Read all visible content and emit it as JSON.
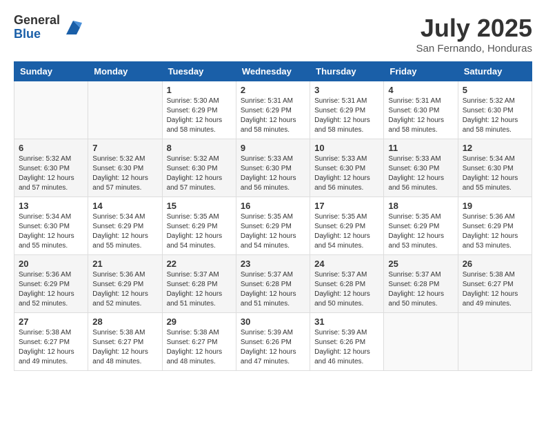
{
  "header": {
    "logo_general": "General",
    "logo_blue": "Blue",
    "month_title": "July 2025",
    "location": "San Fernando, Honduras"
  },
  "days_of_week": [
    "Sunday",
    "Monday",
    "Tuesday",
    "Wednesday",
    "Thursday",
    "Friday",
    "Saturday"
  ],
  "weeks": [
    [
      {
        "day": "",
        "info": ""
      },
      {
        "day": "",
        "info": ""
      },
      {
        "day": "1",
        "info": "Sunrise: 5:30 AM\nSunset: 6:29 PM\nDaylight: 12 hours and 58 minutes."
      },
      {
        "day": "2",
        "info": "Sunrise: 5:31 AM\nSunset: 6:29 PM\nDaylight: 12 hours and 58 minutes."
      },
      {
        "day": "3",
        "info": "Sunrise: 5:31 AM\nSunset: 6:29 PM\nDaylight: 12 hours and 58 minutes."
      },
      {
        "day": "4",
        "info": "Sunrise: 5:31 AM\nSunset: 6:30 PM\nDaylight: 12 hours and 58 minutes."
      },
      {
        "day": "5",
        "info": "Sunrise: 5:32 AM\nSunset: 6:30 PM\nDaylight: 12 hours and 58 minutes."
      }
    ],
    [
      {
        "day": "6",
        "info": "Sunrise: 5:32 AM\nSunset: 6:30 PM\nDaylight: 12 hours and 57 minutes."
      },
      {
        "day": "7",
        "info": "Sunrise: 5:32 AM\nSunset: 6:30 PM\nDaylight: 12 hours and 57 minutes."
      },
      {
        "day": "8",
        "info": "Sunrise: 5:32 AM\nSunset: 6:30 PM\nDaylight: 12 hours and 57 minutes."
      },
      {
        "day": "9",
        "info": "Sunrise: 5:33 AM\nSunset: 6:30 PM\nDaylight: 12 hours and 56 minutes."
      },
      {
        "day": "10",
        "info": "Sunrise: 5:33 AM\nSunset: 6:30 PM\nDaylight: 12 hours and 56 minutes."
      },
      {
        "day": "11",
        "info": "Sunrise: 5:33 AM\nSunset: 6:30 PM\nDaylight: 12 hours and 56 minutes."
      },
      {
        "day": "12",
        "info": "Sunrise: 5:34 AM\nSunset: 6:30 PM\nDaylight: 12 hours and 55 minutes."
      }
    ],
    [
      {
        "day": "13",
        "info": "Sunrise: 5:34 AM\nSunset: 6:30 PM\nDaylight: 12 hours and 55 minutes."
      },
      {
        "day": "14",
        "info": "Sunrise: 5:34 AM\nSunset: 6:29 PM\nDaylight: 12 hours and 55 minutes."
      },
      {
        "day": "15",
        "info": "Sunrise: 5:35 AM\nSunset: 6:29 PM\nDaylight: 12 hours and 54 minutes."
      },
      {
        "day": "16",
        "info": "Sunrise: 5:35 AM\nSunset: 6:29 PM\nDaylight: 12 hours and 54 minutes."
      },
      {
        "day": "17",
        "info": "Sunrise: 5:35 AM\nSunset: 6:29 PM\nDaylight: 12 hours and 54 minutes."
      },
      {
        "day": "18",
        "info": "Sunrise: 5:35 AM\nSunset: 6:29 PM\nDaylight: 12 hours and 53 minutes."
      },
      {
        "day": "19",
        "info": "Sunrise: 5:36 AM\nSunset: 6:29 PM\nDaylight: 12 hours and 53 minutes."
      }
    ],
    [
      {
        "day": "20",
        "info": "Sunrise: 5:36 AM\nSunset: 6:29 PM\nDaylight: 12 hours and 52 minutes."
      },
      {
        "day": "21",
        "info": "Sunrise: 5:36 AM\nSunset: 6:29 PM\nDaylight: 12 hours and 52 minutes."
      },
      {
        "day": "22",
        "info": "Sunrise: 5:37 AM\nSunset: 6:28 PM\nDaylight: 12 hours and 51 minutes."
      },
      {
        "day": "23",
        "info": "Sunrise: 5:37 AM\nSunset: 6:28 PM\nDaylight: 12 hours and 51 minutes."
      },
      {
        "day": "24",
        "info": "Sunrise: 5:37 AM\nSunset: 6:28 PM\nDaylight: 12 hours and 50 minutes."
      },
      {
        "day": "25",
        "info": "Sunrise: 5:37 AM\nSunset: 6:28 PM\nDaylight: 12 hours and 50 minutes."
      },
      {
        "day": "26",
        "info": "Sunrise: 5:38 AM\nSunset: 6:27 PM\nDaylight: 12 hours and 49 minutes."
      }
    ],
    [
      {
        "day": "27",
        "info": "Sunrise: 5:38 AM\nSunset: 6:27 PM\nDaylight: 12 hours and 49 minutes."
      },
      {
        "day": "28",
        "info": "Sunrise: 5:38 AM\nSunset: 6:27 PM\nDaylight: 12 hours and 48 minutes."
      },
      {
        "day": "29",
        "info": "Sunrise: 5:38 AM\nSunset: 6:27 PM\nDaylight: 12 hours and 48 minutes."
      },
      {
        "day": "30",
        "info": "Sunrise: 5:39 AM\nSunset: 6:26 PM\nDaylight: 12 hours and 47 minutes."
      },
      {
        "day": "31",
        "info": "Sunrise: 5:39 AM\nSunset: 6:26 PM\nDaylight: 12 hours and 46 minutes."
      },
      {
        "day": "",
        "info": ""
      },
      {
        "day": "",
        "info": ""
      }
    ]
  ]
}
